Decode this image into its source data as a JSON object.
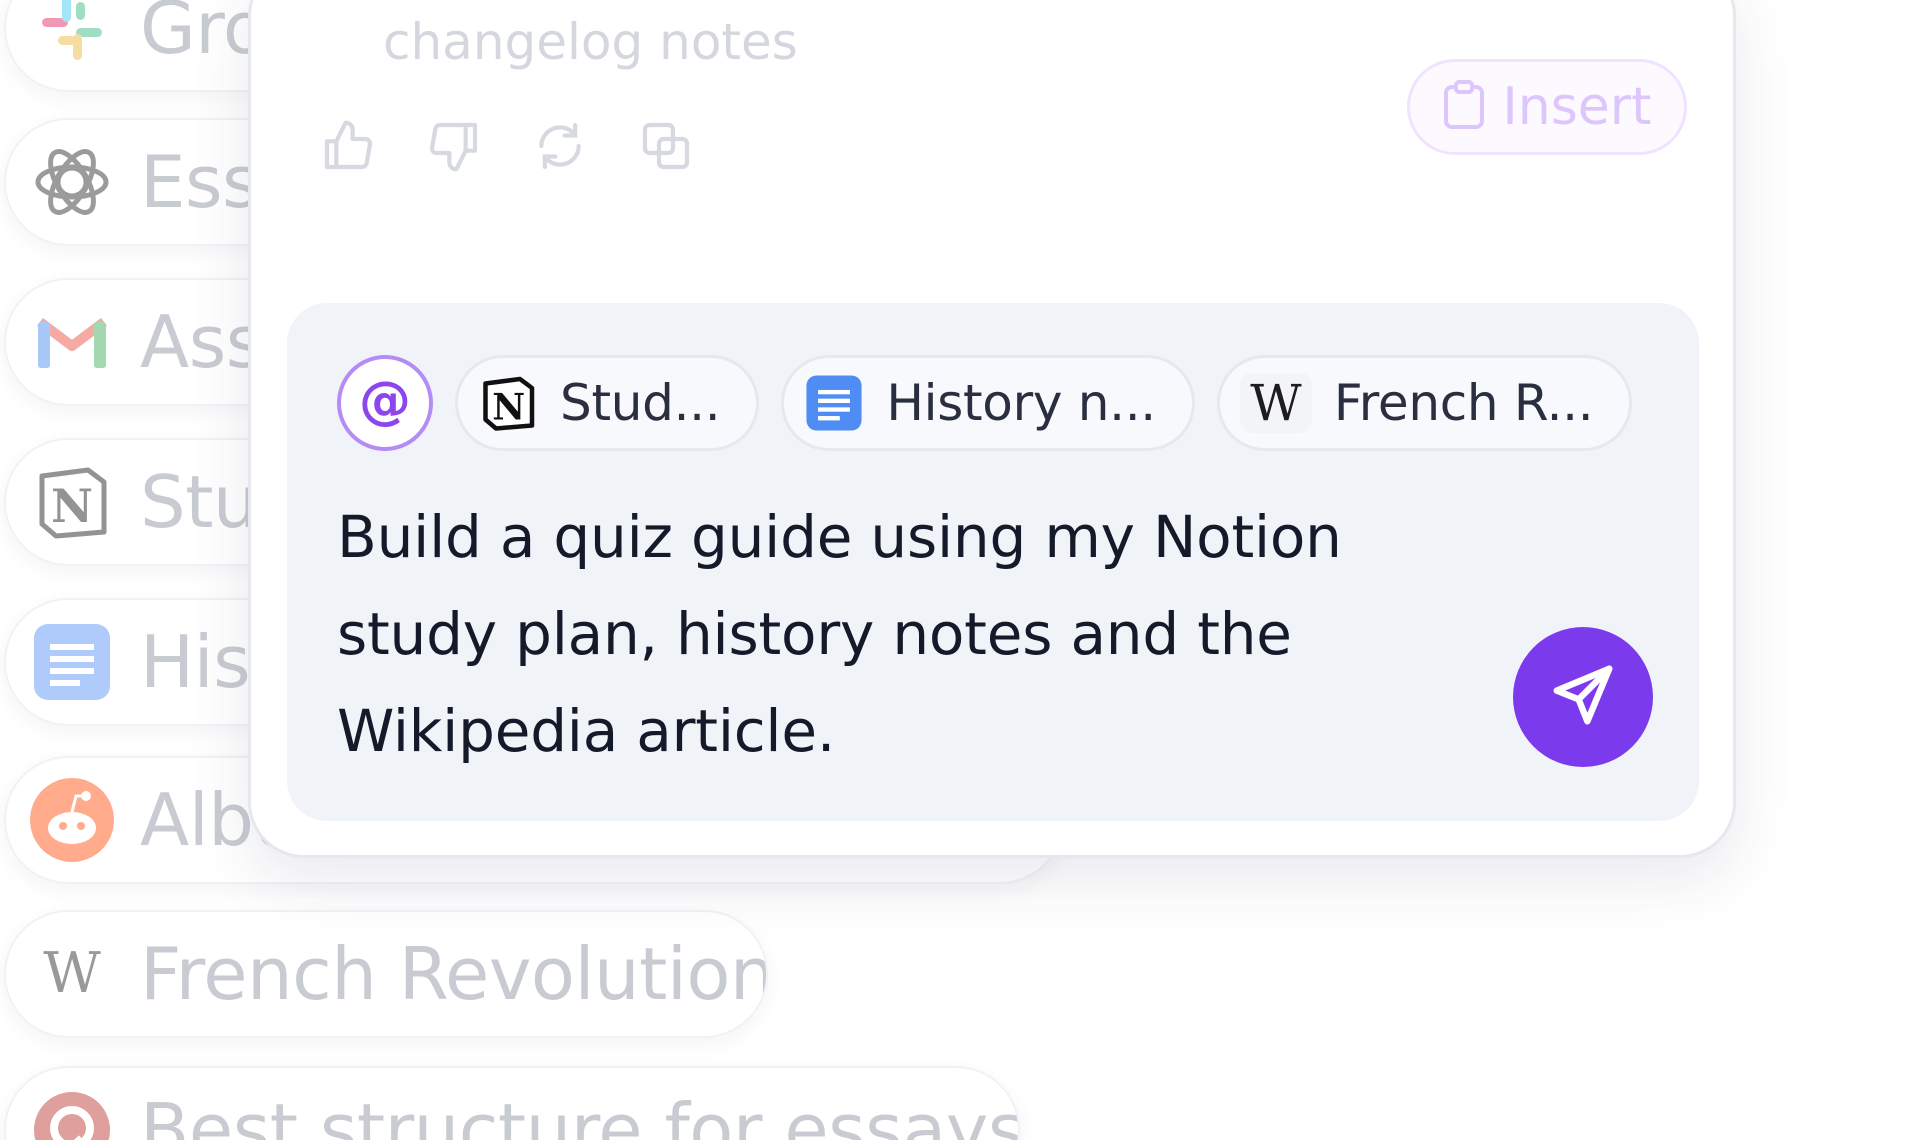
{
  "background_list": {
    "items": [
      {
        "label": "Grocery",
        "icon": "slack-icon"
      },
      {
        "label": "Essay",
        "icon": "openai-icon"
      },
      {
        "label": "Assignment",
        "icon": "gmail-icon"
      },
      {
        "label": "Study",
        "icon": "notion-icon"
      },
      {
        "label": "History",
        "icon": "google-docs-icon"
      },
      {
        "label": "Album",
        "icon": "reddit-icon"
      },
      {
        "label": "French Revolution",
        "icon": "wikipedia-icon"
      },
      {
        "label": "Best structure for essays",
        "icon": "quora-icon"
      }
    ]
  },
  "card": {
    "previous_response_tail": "changelog notes",
    "insert_button_label": "Insert",
    "colors": {
      "accent": "#7c3aed",
      "accent_light": "#b48cf5"
    }
  },
  "composer": {
    "mention_glyph": "@",
    "chips": [
      {
        "label": "Stud...",
        "icon": "notion-icon"
      },
      {
        "label": "History n...",
        "icon": "google-docs-icon"
      },
      {
        "label": "French R...",
        "icon": "wikipedia-icon"
      }
    ],
    "prompt_text": "Build a quiz guide using my Notion study plan, history notes and the Wikipedia article."
  }
}
